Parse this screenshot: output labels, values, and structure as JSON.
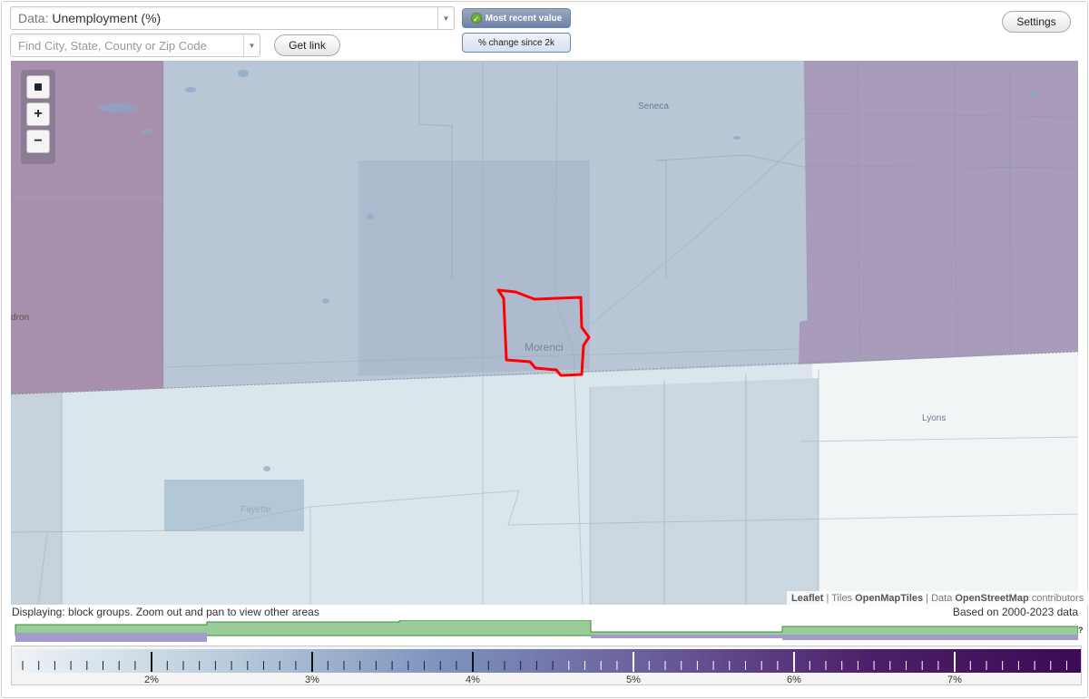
{
  "data_select": {
    "label": "Data:",
    "value": "Unemployment (%)"
  },
  "search": {
    "placeholder": "Find City, State, County or Zip Code"
  },
  "buttons": {
    "get_link": "Get link",
    "settings": "Settings",
    "most_recent": "Most recent value",
    "change_since": "% change since 2k"
  },
  "map": {
    "labels": {
      "morenci": "Morenci",
      "seneca": "Seneca",
      "lyons": "Lyons",
      "fayette": "Fayette",
      "hudson": "dron"
    },
    "colors": {
      "highlight_outline": "#ff0000",
      "low": "#f1f5f7",
      "mid": "#b8c7d8",
      "high": "#a78fae"
    }
  },
  "attribution": {
    "leaflet": "Leaflet",
    "sep1": " | Tiles ",
    "tiles": "OpenMapTiles",
    "sep2": " | Data ",
    "data": "OpenStreetMap",
    "tail": " contributors"
  },
  "info": {
    "displaying": "Displaying: block groups. Zoom out and pan to view other areas",
    "based_on": "Based on 2000-2023 data"
  },
  "histogram": {
    "question": "?",
    "colors": {
      "green": "#99cc99",
      "purple": "#a39bcc"
    }
  },
  "legend": {
    "ticks": [
      "2%",
      "3%",
      "4%",
      "5%",
      "6%",
      "7%"
    ],
    "gradient": [
      "#eef3f6",
      "#b9cbdc",
      "#7d93bd",
      "#6a5c9c",
      "#4d1f6a",
      "#3d0a55"
    ]
  }
}
